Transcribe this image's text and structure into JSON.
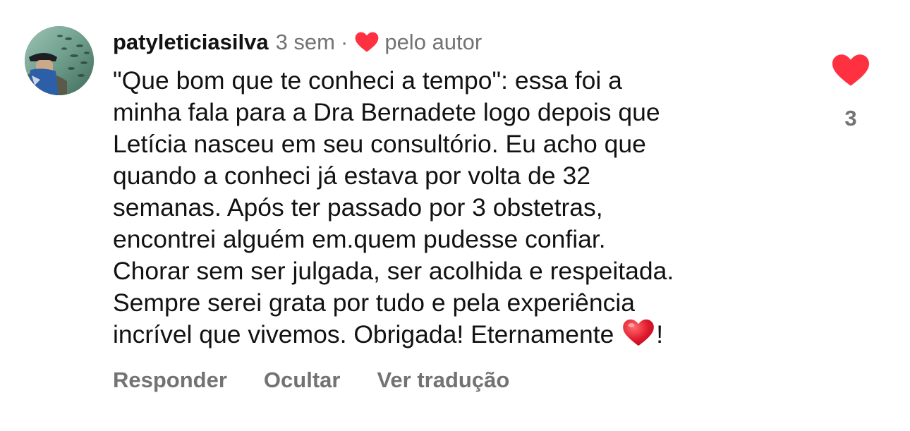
{
  "comment": {
    "username": "patyleticiasilva",
    "time": "3 sem",
    "separator": "·",
    "liked_by_author": "pelo autor",
    "text_lines": [
      "\"Que bom que te conheci a tempo\": essa foi a",
      "minha fala para a Dra Bernadete logo depois que",
      "Letícia nasceu em seu consultório. Eu acho que",
      "quando a conheci já estava por volta de 32",
      "semanas. Após ter passado por 3 obstetras,",
      "encontrei alguém em.quem pudesse confiar.",
      "Chorar sem ser julgada, ser acolhida e respeitada.",
      "Sempre serei grata por tudo e pela experiência",
      "incrível que vivemos. Obrigada! Eternamente"
    ],
    "text_end": "!",
    "emoji": "red-heart-emoji",
    "like_count": "3",
    "heart_color": "#ff3040"
  },
  "actions": {
    "reply": "Responder",
    "hide": "Ocultar",
    "translate": "Ver tradução"
  }
}
